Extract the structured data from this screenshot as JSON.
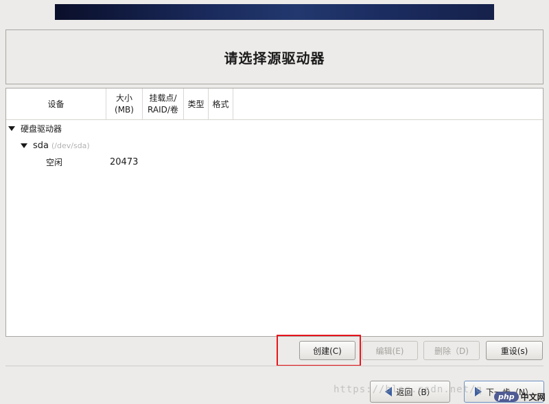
{
  "header": {
    "title": "请选择源驱动器"
  },
  "table": {
    "columns": [
      {
        "line1": "设备",
        "line2": ""
      },
      {
        "line1": "大小",
        "line2": "(MB)"
      },
      {
        "line1": "挂载点/",
        "line2": "RAID/卷"
      },
      {
        "line1": "类型",
        "line2": ""
      },
      {
        "line1": "格式",
        "line2": ""
      }
    ],
    "rows": [
      {
        "label": "硬盘驱动器"
      },
      {
        "label": "sda",
        "sublabel": "(/dev/sda)"
      },
      {
        "label": "空闲",
        "size": "20473"
      }
    ]
  },
  "actions": {
    "create": "创建(C)",
    "edit": "编辑(E)",
    "delete": "删除（D)",
    "reset": "重设(s)"
  },
  "nav": {
    "back": "返回（B）",
    "next": "下一步（N）"
  },
  "watermark": "https://blog.csdn.net/q",
  "logo": {
    "php": "php",
    "cn": "中文网"
  }
}
